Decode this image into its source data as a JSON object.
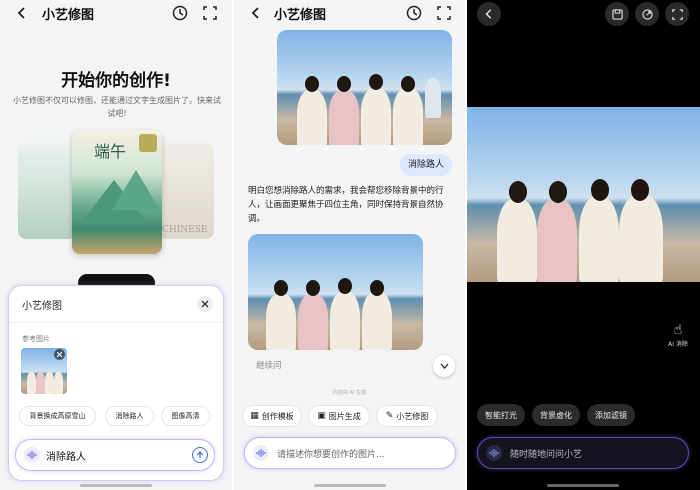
{
  "p1": {
    "title": "小艺修图",
    "hero_title": "开始你的创作!",
    "hero_desc": "小艺修图不仅可以修图，还能通过文字生成图片了。快来试试吧!",
    "card_text": "端午",
    "card_side_text": "CHINESE",
    "sheet_title": "小艺修图",
    "ref_label": "参考图片",
    "chips": [
      "背景换成高原雪山",
      "消除路人",
      "图像高清"
    ],
    "input_value": "消除路人"
  },
  "p2": {
    "title": "小艺修图",
    "user_msg": "消除路人",
    "reply": "明白您想消除路人的需求，我会帮您移除背景中的行人，让画面更聚焦于四位主角，同时保持背景自然协调。",
    "followup": "继续问",
    "ai_note": "内容由 AI 生成",
    "tools": [
      "创作模板",
      "图片生成",
      "小艺修图"
    ],
    "input_placeholder": "请描述你想要创作的图片..."
  },
  "p3": {
    "ai_erase": "AI 消除",
    "tools": [
      "智能打光",
      "背景虚化",
      "添加滤镜"
    ],
    "input_placeholder": "随时随地问问小艺"
  },
  "colors": {
    "accent": "#3b6fe0",
    "user_bubble": "#dde7ff"
  }
}
